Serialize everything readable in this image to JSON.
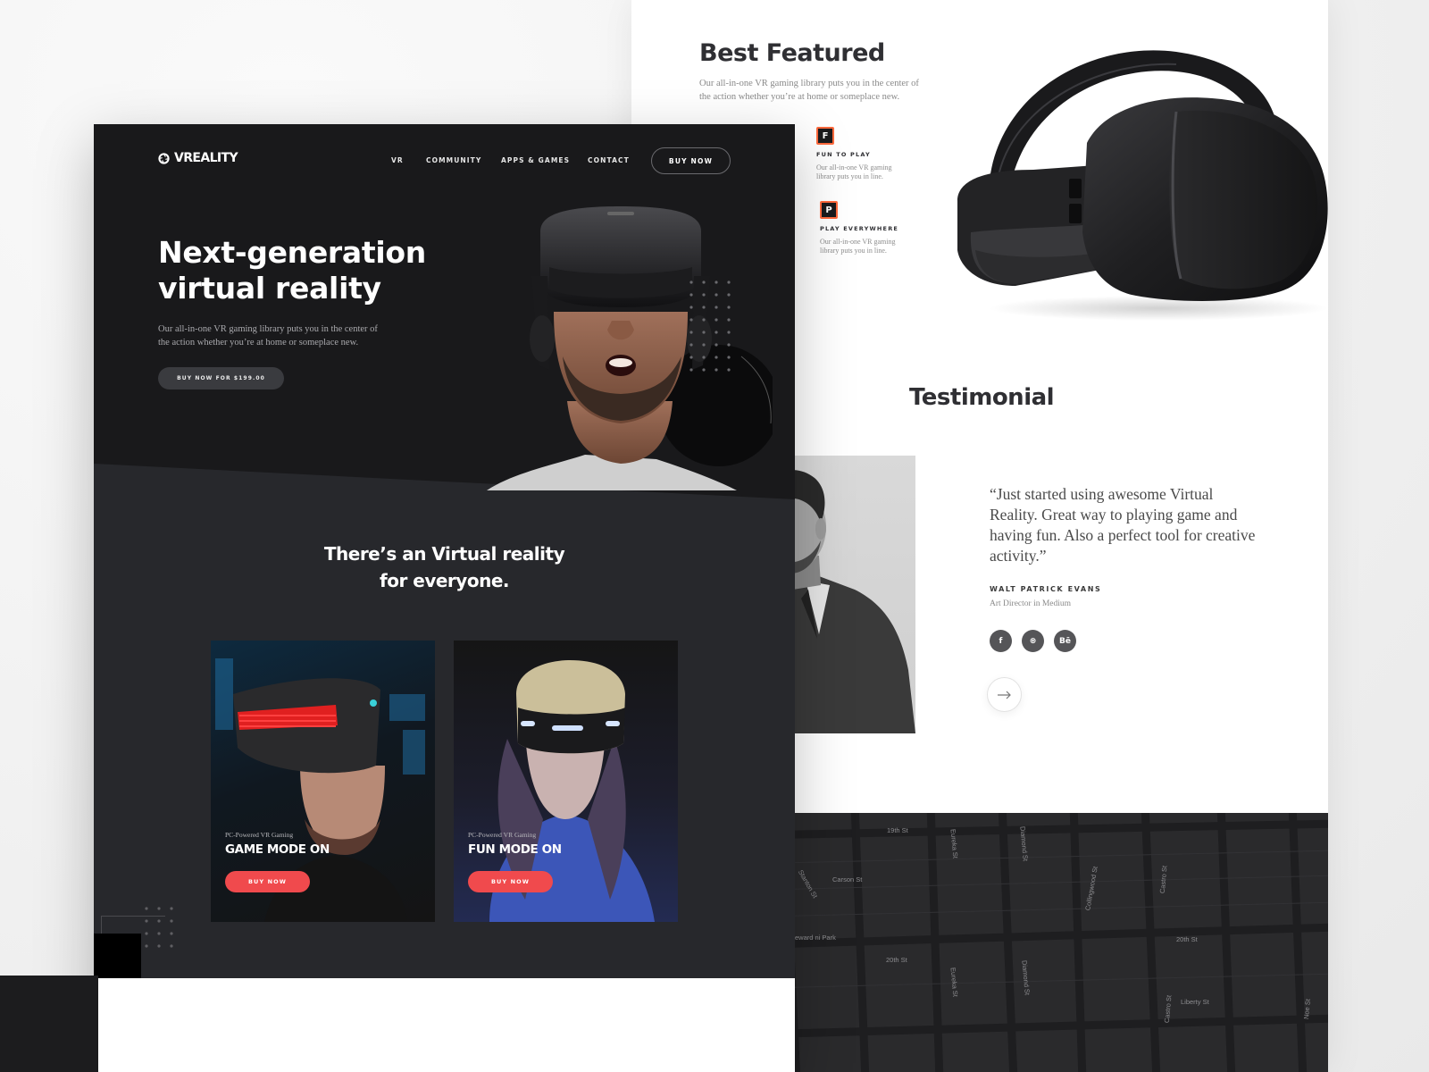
{
  "brand": {
    "name": "VREALITY"
  },
  "nav": {
    "items": [
      "VR",
      "COMMUNITY",
      "APPS & GAMES",
      "CONTACT"
    ],
    "buy_label": "BUY NOW"
  },
  "hero": {
    "title_line1": "Next-generation",
    "title_line2": "virtual reality",
    "description": "Our all-in-one VR gaming library puts you in the center of the action whether you’re at home or someplace new.",
    "cta_label": "BUY NOW FOR $199.00"
  },
  "section2": {
    "title_line1": "There’s an Virtual reality",
    "title_line2": "for everyone."
  },
  "cards": [
    {
      "subtitle": "PC-Powered VR Gaming",
      "title": "GAME MODE ON",
      "button": "BUY NOW"
    },
    {
      "subtitle": "PC-Powered VR Gaming",
      "title": "FUN MODE ON",
      "button": "BUY NOW"
    }
  ],
  "featured": {
    "title": "Best Featured",
    "description": "Our all-in-one VR gaming library puts you in the center of the action whether you’re at home or someplace new.",
    "features": [
      {
        "badge": "F",
        "title": "FUN TO PLAY",
        "text": "Our all-in-one VR gaming library puts you in line."
      },
      {
        "badge": "P",
        "title": "PLAY EVERYWHERE",
        "text": "Our all-in-one VR gaming library puts you in line."
      }
    ]
  },
  "testimonial": {
    "title": "Testimonial",
    "quote": "“Just started using awesome Virtual Reality. Great way to playing game and having fun. Also a perfect tool for creative activity.”",
    "author": "WALT PATRICK EVANS",
    "role": "Art Director in Medium",
    "socials": [
      "f",
      "⊛",
      "Bē"
    ]
  },
  "map": {
    "labels": [
      "19th St",
      "Eureka St",
      "Diamond St",
      "Castro St",
      "Carson St",
      "Collingwood St",
      "Stanton St",
      "20th St",
      "20th St",
      "Eureka St",
      "Diamond St",
      "Castro St",
      "Liberty St",
      "Noe St",
      "eward ni Park"
    ]
  },
  "colors": {
    "accent": "#f04a4d",
    "feature_accent": "#ff6a3d",
    "dark": "#19191b",
    "dark2": "#27282c"
  }
}
